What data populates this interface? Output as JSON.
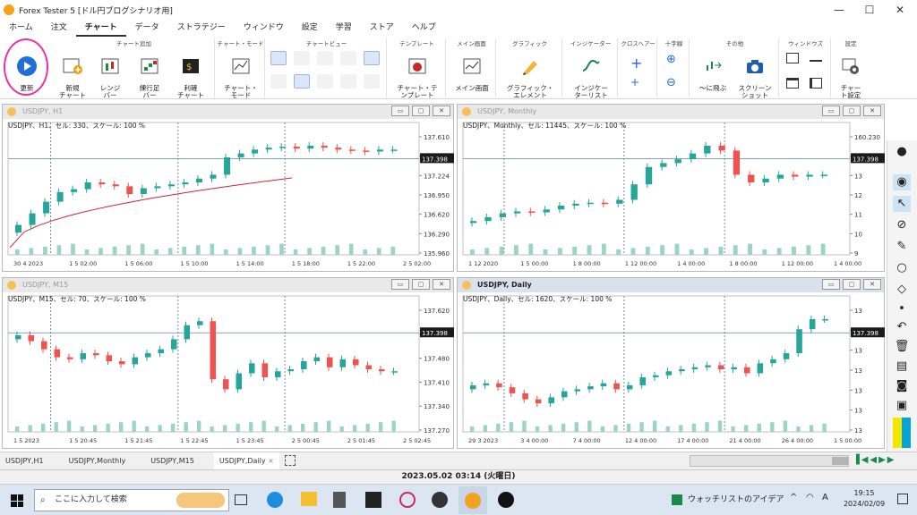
{
  "window": {
    "title": "Forex Tester 5 [ドル円ブログシナリオ用]",
    "minimize": "—",
    "maximize": "☐",
    "close": "✕"
  },
  "menu": [
    "ホーム",
    "注文",
    "チャート",
    "データ",
    "ストラテジー",
    "ウィンドウ",
    "設定",
    "学習",
    "ストア",
    "ヘルプ"
  ],
  "active_menu": "チャート",
  "ribbon": {
    "groups": [
      "チャート追加",
      "チャート・モード",
      "チャートビュー",
      "テンプレート",
      "メイン画面",
      "グラフィック",
      "インジケーター",
      "クロスヘアー",
      "十字線",
      "その他",
      "ウィンドウズ",
      "設定"
    ],
    "buttons": {
      "update": "更新",
      "new_chart": "新規\nチャート",
      "range_bar": "レンジ\nバー",
      "renko": "練行足\nバー",
      "profit_chart": "利確\nチャート",
      "chart_mode": "チャート・\nモード",
      "chart_template": "チャート・テ\nンプレート",
      "main_screen": "メイン画面",
      "graphic_element": "グラフィック・\nエレメント",
      "indicator_list": "インジケー\nターリスト",
      "jump": "〜に飛ぶ",
      "screenshot": "スクリーン\nショット",
      "chart_settings": "チャー\nト設定"
    }
  },
  "panes": [
    {
      "title": "USDJPY, H1",
      "info": "USDJPY、H1、セル: 330、スケール: 100 %",
      "price_labels": [
        "137.610",
        "137.398",
        "137.224",
        "136.950",
        "136.620",
        "136.290",
        "135.960"
      ],
      "time_labels": [
        "30 4 2023",
        "1 5 02:00",
        "1 5 06:00",
        "1 5 10:00",
        "1 5 14:00",
        "1 5 18:00",
        "1 5 22:00",
        "2 5 02:00"
      ],
      "current_price": "137.398",
      "color_current": "#1a1a1a",
      "color_ma": "#d6203a"
    },
    {
      "title": "USDJPY, Monthly",
      "info": "USDJPY、Monthly、セル: 11445、スケール: 100 %",
      "price_labels": [
        "160.230",
        "14",
        "13",
        "12",
        "11",
        "10",
        "9"
      ],
      "time_labels": [
        "1 12 2020",
        "1 5 00:00",
        "1 8 00:00",
        "1 12 00:00",
        "1 4 00:00",
        "1 8 00:00",
        "1 12 00:00",
        "1 4 00:00"
      ],
      "current_price": "137.398"
    },
    {
      "title": "USDJPY, M15",
      "info": "USDJPY、M15、セル: 70、スケール: 100 %",
      "price_labels": [
        "137.620",
        "137.550",
        "137.480",
        "137.410",
        "137.340",
        "137.270"
      ],
      "time_labels": [
        "1 5 2023",
        "1 5 20:45",
        "1 5 21:45",
        "1 5 22:45",
        "1 5 23:45",
        "2 5 00:45",
        "2 5 01:45",
        "2 5 02:45"
      ],
      "current_price": "137.398"
    },
    {
      "title": "USDJPY, Daily",
      "info": "USDJPY、Daily、セル: 1620、スケール: 100 %",
      "price_labels": [
        "13",
        "13",
        "13",
        "13",
        "13",
        "13",
        "13"
      ],
      "time_labels": [
        "29 3 2023",
        "3 4 00:00",
        "7 4 00:00",
        "12 4 00:00",
        "17 4 00:00",
        "21 4 00:00",
        "26 4 00:00",
        "1 5 00:00"
      ],
      "current_price": "137.398"
    }
  ],
  "tabs": [
    "USDJPY,H1",
    "USDJPY,Monthly",
    "USDJPY,M15",
    "USDJPY,Daily"
  ],
  "tab_close": "×",
  "active_tab": "USDJPY,Daily",
  "status_time": "2023.05.02 03:14 (火曜日)",
  "taskbar": {
    "search_placeholder": "ここに入力して検索",
    "news": "ウォッチリストのアイデア",
    "ime": "A",
    "clock_time": "19:15",
    "clock_date": "2024/02/09"
  },
  "colors": {
    "bull": "#26a69a",
    "bear": "#ef5350",
    "accent": "#1e6fd9",
    "ma": "#d6203a"
  }
}
